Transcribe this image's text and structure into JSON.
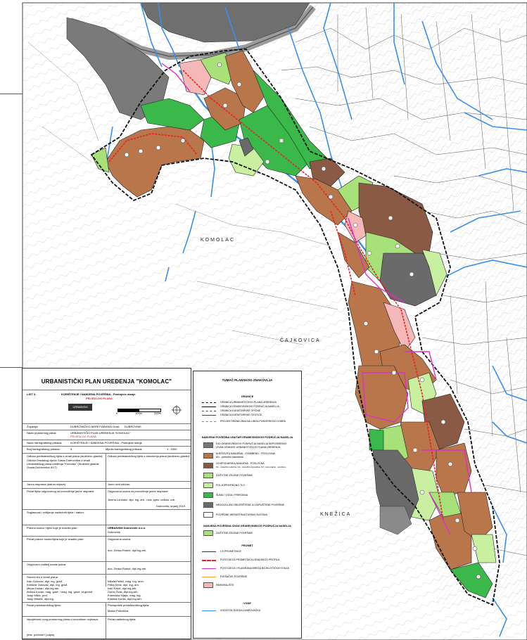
{
  "place_labels": {
    "komolac": "KOMOLAC",
    "cajkovica": "ČAJKOVICA",
    "knezica": "KNEŽICA"
  },
  "title_block": {
    "title": "URBANISTIČKI PLAN UREĐENJA \"KOMOLAC\"",
    "sheet_no": "LIST 3.",
    "sheet_name": "KORIŠTENJE I NAMJENA POVRŠINA - Postojeće stanje",
    "sheet_name2": "PRIJEDLOG PLANA",
    "logo": "URBANISM",
    "scale_ticks": [
      "0",
      "100m",
      "200m"
    ],
    "rows": [
      {
        "label": "Županija:",
        "value": "DUBROVAČKO-NERETVANSKA",
        "label2": "Grad:",
        "value2": "DUBROVNIK"
      },
      {
        "label": "Naziv prostornog plana:",
        "value": "URBANISTIČKI PLAN UREĐENJA \"KOMOLAC\"",
        "value_red": "PRIJEDLOG PLANA"
      },
      {
        "label": "Naziv kartografskog prikaza:",
        "value": "KORIŠTENJE I NAMJENA POVRŠINA - Postojeće stanje"
      },
      {
        "label": "Broj kartografskog prikaza:",
        "value": "3.",
        "label2": "Mjerilo kartografskog prikaza:",
        "value2": "1 : 2000"
      }
    ],
    "odluka_label": "Odluka predstavničkog tijela o izradi plana (službeno glasilo):",
    "odluka_text": "Odluka Gradskog vijeća Grada Dubrovnika o izradi Urbanističkog plana uređenja \"Komolac\" (Službeni glasnik Grada Dubrovnika 9/17)",
    "odluka_right": "Odluka predstavničkog tijela o donošenju plana (službeno glasilo):",
    "javna_rasprava": "Javna rasprava (datum objave):",
    "javni_uvid": "Javni uvid održan:",
    "pecat_tijela": "Pečat tijela odgovornog za provođenje javne rasprave:",
    "odgovorna_osoba": "Odgovorna osoba za provođenje javne rasprave:",
    "odgovorna_ime": "Jelena Lončarić, dipl. ing. arh., univ. spec. oekolo. urb.",
    "suglasnost": "Suglasnost / mišljenje nadležnih tijela / datum:",
    "datum": "Dubrovnik, srpanj 2019.",
    "izradjivac_label": "Pravna osoba / tijelo koje je izradilo plan:",
    "izradjivac": "URBANISM Dubrovnik d.o.o.",
    "izradjivac_city": "Dubrovnik",
    "pecat_izradjivaca": "Pečat pravne osobe/tijela koje je izradilo plan:",
    "odgovorna_osoba2": "Odgovorna osoba:",
    "odgovorna_ime2": "doc. Zrinka Rudež, dipl.ing.arh.",
    "voditelj_label": "Odgovorni voditelj izrade plana:",
    "voditelj_ime": "doc. Zrinka Rudež, dipl.ing.arh.",
    "tim_label": "Stručni tim u izradi plana:",
    "tim_left": [
      "Ivan Gotovac, dipl. ing. građ.",
      "Kresimir Gotovac, dipl. ing. građ.",
      "Mirjan Dukan, dipl.ing.arh.",
      "Ankica Kovač, mag. građ. / mag. ing. geod. et geoinf.",
      "Josip Mikić, prof.",
      "Josip Mihelić, dipl.ing."
    ],
    "tim_right": [
      "Nikola Pehlić, mag. ing. arch.",
      "Petra Kerić, dipl. ing. arh.",
      "Ivan Kačić, dipl.ing.arh.",
      "Ozren Šolić, dipl.ing.arh.",
      "Franciska Kljajić, mag. ing.",
      "Kristina Kordić, dipl.ing.arh."
    ],
    "pecat_gradskog": "Pečat predstavničkog tijela:",
    "predsjednik": "Predsjednik predstavničkog tijela:",
    "predsjednik_ime": "Marko Potrebica",
    "istovjetnost": "Istovjetnost ovog prostornog plana s izvornikom ovjerava:",
    "pecat_nadleznog": "Pečat nadležnog tijela:",
    "ime_potpis": "(ime, prezime i potpis)"
  },
  "legend": {
    "header": "TUMAČ PLANSKOG ZNAKOVLJA",
    "granice_header": "GRANICE",
    "granice": [
      "GRANICA URBANISTIČKOG PLANA UREĐENJA",
      "GRANICA GRAĐEVINSKOG PODRUČJA NASELJA",
      "GRANICA KATASTARSKE OPĆINE",
      "GRANICA KATASTARSKE ČESTICE",
      "PROJEKTIRANA OBALNA LINIJA POMORSKOG DOBRA"
    ],
    "namjena_header": "NAMJENA POVRŠINA UNUTAR GRAĐEVINSKOG PODRUČJA NASELJA",
    "namjena_note": [
      "DIO GRAĐEVINSKOG PODRUČJA NASELJA NEPOSREDNO",
      "IZVAN GRANICE URBANISTIČKOG PLANA UREĐENJA"
    ],
    "namjena": [
      {
        "text": "MJEŠOVITA NAMJENA - STAMBENO - POSLOVNA",
        "sub": "M1 - pretežito stambena",
        "color": "#b9764a"
      },
      {
        "text": "GOSPODARSKA NAMJENA - POSLOVNA",
        "sub": "K1 - pretežito uslužna, K2 - pretežito trgovačka, K3 - komunalno - servisna",
        "color": "#8a5a45"
      },
      {
        "text": "ZAŠTITNE ZELENE POVRŠINE",
        "sub": "",
        "color": "#a8e07a"
      },
      {
        "text": "POLJOPRIVREDNO TLO",
        "sub": "",
        "color": "#c8f0a0"
      },
      {
        "text": "ŠUMA / VODA / PRIRODNA",
        "sub": "",
        "color": "#3ab84a"
      },
      {
        "text": "NEDOVOLJNO ISKORIŠTENE ILI ZAPUŠTENE POVRŠINE",
        "sub": "",
        "color": "#6a6a6a"
      },
      {
        "text": "POVRŠINE INFRASTRUKTURNIH SUSTAVA",
        "sub": "",
        "color": "#ffffff"
      }
    ],
    "izvan_header": "NAMJENA POVRŠINA IZVAN GRAĐEVINSKOG PODRUČJA NASELJA",
    "izvan": [
      {
        "text": "ZAŠTITNE ZELENE POVRŠINE",
        "color": "#a8e07a"
      }
    ],
    "promet_header": "PROMET",
    "promet": [
      "CS PROMETNICE",
      "POSTOJEĆA PROMETNICA GRADSKOG PROFILA",
      "POSTOJEĆA I PLANIRANA MREŽA BICIKLISTIČKIH STAZA",
      "PJEŠAČKE POVRŠINE",
      "PARKIRALIŠTE"
    ],
    "voda_header": "VODE",
    "voda": [
      "VODOTOK RIJEKA DUBROVAČKA"
    ]
  },
  "colors": {
    "residential": "#b9764a",
    "business": "#8a5a45",
    "green_protect": "#a8e07a",
    "green_light": "#c8f0a0",
    "forest": "#3ab84a",
    "grey_area": "#6a6a6a",
    "pink": "#f4b8b8",
    "water_blue": "#3b8fe6",
    "road_red": "#e3232b",
    "bike_magenta": "#d931c9"
  }
}
